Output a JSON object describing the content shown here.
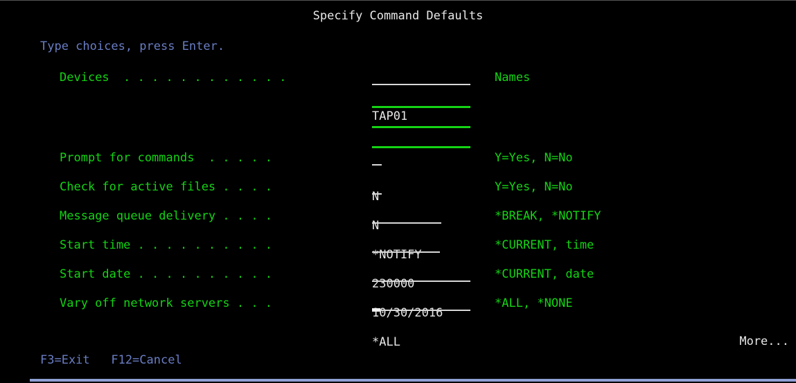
{
  "screen": {
    "title": "Specify Command Defaults",
    "instruction": "Type choices, press Enter.",
    "more_indicator": "More...",
    "function_keys": "F3=Exit   F12=Cancel",
    "colors": {
      "background": "#000000",
      "label_green": "#14d414",
      "value_white": "#e8e8e8",
      "accent_blue": "#6a7ec4",
      "status_bar": "#8f9fd4"
    }
  },
  "fields": [
    {
      "label": "Devices  . . . . . . . . . . . .",
      "value": "TAP01",
      "underline_width": 142,
      "underline_color": "white",
      "hint": "Names",
      "cursor": false
    },
    {
      "label": "Prompt for commands  . . . . .",
      "value": "N",
      "underline_width": 14,
      "underline_color": "white",
      "hint": "Y=Yes, N=No",
      "cursor": false
    },
    {
      "label": "Check for active files . . . .",
      "value": "N",
      "underline_width": 14,
      "underline_color": "white",
      "hint": "Y=Yes, N=No",
      "cursor": false
    },
    {
      "label": "Message queue delivery . . . .",
      "value": "*NOTIFY",
      "underline_width": 100,
      "underline_color": "white",
      "hint": "*BREAK, *NOTIFY",
      "cursor": false
    },
    {
      "label": "Start time . . . . . . . . . .",
      "value": "230000",
      "underline_width": 98,
      "underline_color": "white",
      "hint": "*CURRENT, time",
      "cursor": false
    },
    {
      "label": "Start date . . . . . . . . . .",
      "value": "10/30/2016",
      "underline_width": 142,
      "underline_color": "white",
      "hint": "*CURRENT, date",
      "cursor": false
    },
    {
      "label": "Vary off network servers . . .",
      "value": "*ALL",
      "underline_width": 142,
      "underline_color": "white",
      "hint": "*ALL, *NONE",
      "cursor": true
    }
  ],
  "continuation_fields": [
    {
      "value": "",
      "underline_width": 142,
      "underline_color": "green"
    },
    {
      "value": "",
      "underline_width": 142,
      "underline_color": "green"
    },
    {
      "value": "",
      "underline_width": 142,
      "underline_color": "green"
    }
  ]
}
